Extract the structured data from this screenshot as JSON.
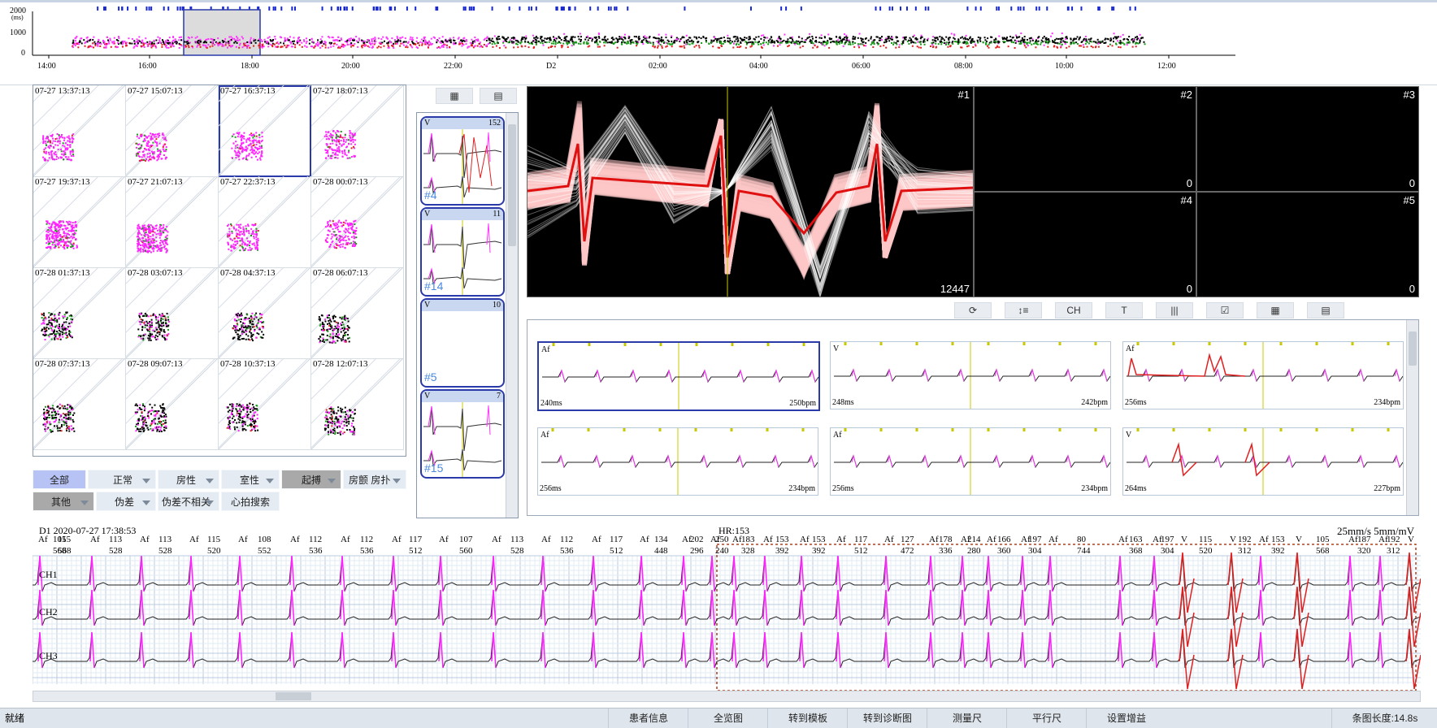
{
  "trend": {
    "y_ticks": [
      "2000",
      "(ms)",
      "1000",
      "0"
    ],
    "time_ticks": [
      "14:00",
      "16:00",
      "18:00",
      "20:00",
      "22:00",
      "D2",
      "02:00",
      "04:00",
      "06:00",
      "08:00",
      "10:00",
      "12:00"
    ]
  },
  "scatter": {
    "cells": [
      "07-27 13:37:13",
      "07-27 15:07:13",
      "07-27 16:37:13",
      "07-27 18:07:13",
      "07-27 19:37:13",
      "07-27 21:07:13",
      "07-27 22:37:13",
      "07-28 00:07:13",
      "07-28 01:37:13",
      "07-28 03:07:13",
      "07-28 04:37:13",
      "07-28 06:07:13",
      "07-28 07:37:13",
      "07-28 09:07:13",
      "07-28 10:37:13",
      "07-28 12:07:13"
    ]
  },
  "filters": {
    "all": "全部",
    "normal": "正常",
    "atrial": "房性",
    "ventricular": "室性",
    "pacing": "起搏",
    "flutter": "房颤 房扑",
    "other": "其他",
    "artifact": "伪差",
    "artifact_unrelated": "伪差不相关",
    "beat_search": "心拍搜索"
  },
  "templates": [
    {
      "type": "V",
      "count": "152",
      "id": "#4"
    },
    {
      "type": "V",
      "count": "11",
      "id": "#14"
    },
    {
      "type": "V",
      "count": "10",
      "id": "#5"
    },
    {
      "type": "V",
      "count": "7",
      "id": "#15"
    }
  ],
  "overlay": {
    "main_id": "#1",
    "main_count": "12447",
    "others": [
      {
        "id": "#2",
        "count": "0"
      },
      {
        "id": "#3",
        "count": "0"
      },
      {
        "id": "#4",
        "count": "0"
      },
      {
        "id": "#5",
        "count": "0"
      }
    ]
  },
  "strip_toolbar": [
    "⟳",
    "↕≡",
    "CH",
    "T",
    "|||",
    "☑",
    "▦",
    "▤"
  ],
  "strips": [
    {
      "label": "Af",
      "rr": "240ms",
      "rate": "250bpm"
    },
    {
      "label": "V",
      "rr": "248ms",
      "rate": "242bpm"
    },
    {
      "label": "Af",
      "rr": "256ms",
      "rate": "234bpm"
    },
    {
      "label": "Af",
      "rr": "256ms",
      "rate": "234bpm"
    },
    {
      "label": "Af",
      "rr": "256ms",
      "rate": "234bpm"
    },
    {
      "label": "V",
      "rr": "264ms",
      "rate": "227bpm"
    }
  ],
  "ecg": {
    "header_left": "D1 2020-07-27 17:38:53",
    "hr": "HR:153",
    "scale": "25mm/s 5mm/mV",
    "channels": [
      "CH1",
      "CH2",
      "CH3"
    ],
    "beats": [
      {
        "t": "Af",
        "n1": "105",
        "n2": "568"
      },
      {
        "t": "Af",
        "n1": "115",
        "n2": "568"
      },
      {
        "t": "Af",
        "n1": "113",
        "n2": "528"
      },
      {
        "t": "Af",
        "n1": "113",
        "n2": "528"
      },
      {
        "t": "Af",
        "n1": "115",
        "n2": "520"
      },
      {
        "t": "Af",
        "n1": "108",
        "n2": "552"
      },
      {
        "t": "Af",
        "n1": "112",
        "n2": "536"
      },
      {
        "t": "Af",
        "n1": "112",
        "n2": "536"
      },
      {
        "t": "Af",
        "n1": "117",
        "n2": "512"
      },
      {
        "t": "Af",
        "n1": "107",
        "n2": "560"
      },
      {
        "t": "Af",
        "n1": "113",
        "n2": "528"
      },
      {
        "t": "Af",
        "n1": "112",
        "n2": "536"
      },
      {
        "t": "Af",
        "n1": "117",
        "n2": "512"
      },
      {
        "t": "Af",
        "n1": "134",
        "n2": "448"
      },
      {
        "t": "Af",
        "n1": "202",
        "n2": "296"
      },
      {
        "t": "Af",
        "n1": "250",
        "n2": "240"
      },
      {
        "t": "Af",
        "n1": "183",
        "n2": "328"
      },
      {
        "t": "Af",
        "n1": "153",
        "n2": "392"
      },
      {
        "t": "Af",
        "n1": "153",
        "n2": "392"
      },
      {
        "t": "Af",
        "n1": "117",
        "n2": "512"
      },
      {
        "t": "Af",
        "n1": "127",
        "n2": "472"
      },
      {
        "t": "Af",
        "n1": "178",
        "n2": "336"
      },
      {
        "t": "Af",
        "n1": "214",
        "n2": "280"
      },
      {
        "t": "Af",
        "n1": "166",
        "n2": "360"
      },
      {
        "t": "Af",
        "n1": "197",
        "n2": "304"
      },
      {
        "t": "Af",
        "n1": "80",
        "n2": "744"
      },
      {
        "t": "Af",
        "n1": "163",
        "n2": "368"
      },
      {
        "t": "V",
        "n1": "197",
        "n2": "304"
      },
      {
        "t": "V",
        "n1": "115",
        "n2": "520"
      },
      {
        "t": "Af",
        "n1": "192",
        "n2": "312"
      },
      {
        "t": "V",
        "n1": "153",
        "n2": "392"
      },
      {
        "t": "Af",
        "n1": "105",
        "n2": "568"
      },
      {
        "t": "Af",
        "n1": "187",
        "n2": "320"
      },
      {
        "t": "V",
        "n1": "192",
        "n2": "312"
      }
    ]
  },
  "status": {
    "ready": "就绪",
    "buttons": [
      "患者信息",
      "全览图",
      "转到模板",
      "转到诊断图",
      "测量尺",
      "平行尺",
      "设置增益"
    ],
    "strip_length": "条图长度:14.8s"
  }
}
